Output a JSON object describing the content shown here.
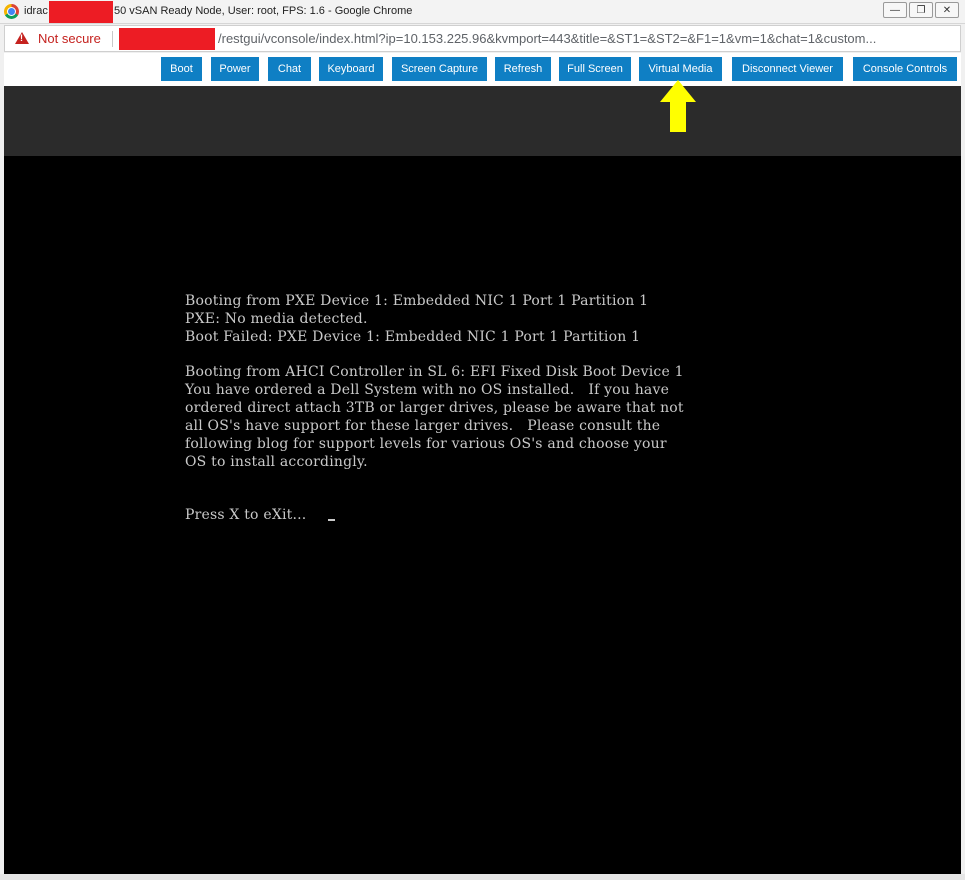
{
  "window": {
    "title_prefix": "idrac",
    "title_suffix": "50 vSAN Ready Node, User: root, FPS: 1.6 - Google Chrome",
    "controls": [
      "minimize",
      "restore",
      "close"
    ]
  },
  "address_bar": {
    "security_label": "Not secure",
    "url": "/restgui/vconsole/index.html?ip=10.153.225.96&kvmport=443&title=&ST1=&ST2=&F1=1&vm=1&chat=1&custom..."
  },
  "toolbar": {
    "buttons": [
      "Boot",
      "Power",
      "Chat",
      "Keyboard",
      "Screen Capture",
      "Refresh",
      "Full Screen",
      "Virtual Media",
      "Disconnect Viewer",
      "Console Controls"
    ],
    "button_color": "#0f7fc4",
    "highlighted": "Virtual Media",
    "highlight_arrow_color": "#ffff00"
  },
  "console": {
    "lines": [
      "Booting from PXE Device 1: Embedded NIC 1 Port 1 Partition 1",
      "PXE: No media detected.",
      "Boot Failed: PXE Device 1: Embedded NIC 1 Port 1 Partition 1",
      "Booting from AHCI Controller in SL 6: EFI Fixed Disk Boot Device 1",
      "You have ordered a Dell System with no OS installed.   If you have",
      "ordered direct attach 3TB or larger drives, please be aware that not",
      "all OS's have support for these larger drives.   Please consult the",
      "following blog for support levels for various OS's and choose your",
      "OS to install accordingly.",
      "Press X to eXit..."
    ]
  }
}
